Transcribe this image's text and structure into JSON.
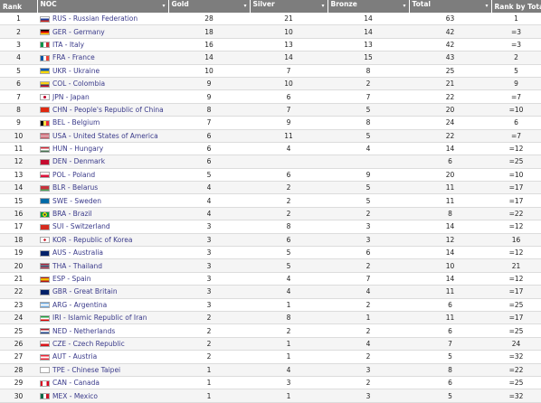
{
  "headers": {
    "rank": "Rank",
    "noc": "NOC",
    "gold": "Gold",
    "silver": "Silver",
    "bronze": "Bronze",
    "total": "Total",
    "rank_by_total": "Rank by Total",
    "sort_icon": "▾"
  },
  "rows": [
    {
      "rank": "1",
      "noc": "RUS - Russian Federation",
      "gold": "28",
      "silver": "21",
      "bronze": "14",
      "total": "63",
      "rbt": "1",
      "flag": "linear-gradient(#ffffff 33%,#1c3f9e 33% 66%,#d52b1e 66%)"
    },
    {
      "rank": "2",
      "noc": "GER - Germany",
      "gold": "18",
      "silver": "10",
      "bronze": "14",
      "total": "42",
      "rbt": "=3",
      "flag": "linear-gradient(#000000 33%,#dd0000 33% 66%,#ffce00 66%)"
    },
    {
      "rank": "3",
      "noc": "ITA - Italy",
      "gold": "16",
      "silver": "13",
      "bronze": "13",
      "total": "42",
      "rbt": "=3",
      "flag": "linear-gradient(90deg,#009246 33%,#ffffff 33% 66%,#ce2b37 66%)"
    },
    {
      "rank": "4",
      "noc": "FRA - France",
      "gold": "14",
      "silver": "14",
      "bronze": "15",
      "total": "43",
      "rbt": "2",
      "flag": "linear-gradient(90deg,#0055a4 33%,#ffffff 33% 66%,#ef4135 66%)"
    },
    {
      "rank": "5",
      "noc": "UKR - Ukraine",
      "gold": "10",
      "silver": "7",
      "bronze": "8",
      "total": "25",
      "rbt": "5",
      "flag": "linear-gradient(#0057b7 50%,#ffd700 50%)"
    },
    {
      "rank": "6",
      "noc": "COL - Colombia",
      "gold": "9",
      "silver": "10",
      "bronze": "2",
      "total": "21",
      "rbt": "9",
      "flag": "linear-gradient(#fcd116 50%,#003893 50% 75%,#ce1126 75%)"
    },
    {
      "rank": "7",
      "noc": "JPN - Japan",
      "gold": "9",
      "silver": "6",
      "bronze": "7",
      "total": "22",
      "rbt": "=7",
      "flag": "radial-gradient(circle,#bc002d 28%,#ffffff 30%)"
    },
    {
      "rank": "8",
      "noc": "CHN - People's Republic of China",
      "gold": "8",
      "silver": "7",
      "bronze": "5",
      "total": "20",
      "rbt": "=10",
      "flag": "linear-gradient(#de2910,#de2910)"
    },
    {
      "rank": "9",
      "noc": "BEL - Belgium",
      "gold": "7",
      "silver": "9",
      "bronze": "8",
      "total": "24",
      "rbt": "6",
      "flag": "linear-gradient(90deg,#000000 33%,#fae042 33% 66%,#ed2939 66%)"
    },
    {
      "rank": "10",
      "noc": "USA - United States of America",
      "gold": "6",
      "silver": "11",
      "bronze": "5",
      "total": "22",
      "rbt": "=7",
      "flag": "repeating-linear-gradient(#b22234 0 1px,#ffffff 1px 2px)"
    },
    {
      "rank": "11",
      "noc": "HUN - Hungary",
      "gold": "6",
      "silver": "4",
      "bronze": "4",
      "total": "14",
      "rbt": "=12",
      "flag": "linear-gradient(#ce2939 33%,#ffffff 33% 66%,#477050 66%)"
    },
    {
      "rank": "12",
      "noc": "DEN - Denmark",
      "gold": "6",
      "silver": "",
      "bronze": "",
      "total": "6",
      "rbt": "=25",
      "flag": "linear-gradient(#c60c30,#c60c30)"
    },
    {
      "rank": "13",
      "noc": "POL - Poland",
      "gold": "5",
      "silver": "6",
      "bronze": "9",
      "total": "20",
      "rbt": "=10",
      "flag": "linear-gradient(#ffffff 50%,#dc143c 50%)"
    },
    {
      "rank": "14",
      "noc": "BLR - Belarus",
      "gold": "4",
      "silver": "2",
      "bronze": "5",
      "total": "11",
      "rbt": "=17",
      "flag": "linear-gradient(#c8313e 66%,#4aa657 66%)"
    },
    {
      "rank": "15",
      "noc": "SWE - Sweden",
      "gold": "4",
      "silver": "2",
      "bronze": "5",
      "total": "11",
      "rbt": "=17",
      "flag": "linear-gradient(#006aa7,#006aa7)"
    },
    {
      "rank": "16",
      "noc": "BRA - Brazil",
      "gold": "4",
      "silver": "2",
      "bronze": "2",
      "total": "8",
      "rbt": "=22",
      "flag": "radial-gradient(circle,#002776 20%,#fedf00 22% 45%,#009c3b 47%)"
    },
    {
      "rank": "17",
      "noc": "SUI - Switzerland",
      "gold": "3",
      "silver": "8",
      "bronze": "3",
      "total": "14",
      "rbt": "=12",
      "flag": "linear-gradient(#d52b1e,#d52b1e)"
    },
    {
      "rank": "18",
      "noc": "KOR - Republic of Korea",
      "gold": "3",
      "silver": "6",
      "bronze": "3",
      "total": "12",
      "rbt": "16",
      "flag": "radial-gradient(circle,#cd2e3a 25%,#ffffff 28%)"
    },
    {
      "rank": "19",
      "noc": "AUS - Australia",
      "gold": "3",
      "silver": "5",
      "bronze": "6",
      "total": "14",
      "rbt": "=12",
      "flag": "linear-gradient(#012169,#012169)"
    },
    {
      "rank": "20",
      "noc": "THA - Thailand",
      "gold": "3",
      "silver": "5",
      "bronze": "2",
      "total": "10",
      "rbt": "21",
      "flag": "linear-gradient(#a51931 16%,#f4f5f8 16% 33%,#2d2a4a 33% 66%,#f4f5f8 66% 83%,#a51931 83%)"
    },
    {
      "rank": "21",
      "noc": "ESP - Spain",
      "gold": "3",
      "silver": "4",
      "bronze": "7",
      "total": "14",
      "rbt": "=12",
      "flag": "linear-gradient(#aa151b 25%,#f1bf00 25% 75%,#aa151b 75%)"
    },
    {
      "rank": "22",
      "noc": "GBR - Great Britain",
      "gold": "3",
      "silver": "4",
      "bronze": "4",
      "total": "11",
      "rbt": "=17",
      "flag": "linear-gradient(#012169,#012169)"
    },
    {
      "rank": "23",
      "noc": "ARG - Argentina",
      "gold": "3",
      "silver": "1",
      "bronze": "2",
      "total": "6",
      "rbt": "=25",
      "flag": "linear-gradient(#74acdf 33%,#ffffff 33% 66%,#74acdf 66%)"
    },
    {
      "rank": "24",
      "noc": "IRI - Islamic Republic of Iran",
      "gold": "2",
      "silver": "8",
      "bronze": "1",
      "total": "11",
      "rbt": "=17",
      "flag": "linear-gradient(#239f40 33%,#ffffff 33% 66%,#da0000 66%)"
    },
    {
      "rank": "25",
      "noc": "NED - Netherlands",
      "gold": "2",
      "silver": "2",
      "bronze": "2",
      "total": "6",
      "rbt": "=25",
      "flag": "linear-gradient(#ae1c28 33%,#ffffff 33% 66%,#21468b 66%)"
    },
    {
      "rank": "26",
      "noc": "CZE - Czech Republic",
      "gold": "2",
      "silver": "1",
      "bronze": "4",
      "total": "7",
      "rbt": "24",
      "flag": "linear-gradient(#ffffff 50%,#d7141a 50%)"
    },
    {
      "rank": "27",
      "noc": "AUT - Austria",
      "gold": "2",
      "silver": "1",
      "bronze": "2",
      "total": "5",
      "rbt": "=32",
      "flag": "linear-gradient(#ed2939 33%,#ffffff 33% 66%,#ed2939 66%)"
    },
    {
      "rank": "28",
      "noc": "TPE - Chinese Taipei",
      "gold": "1",
      "silver": "4",
      "bronze": "3",
      "total": "8",
      "rbt": "=22",
      "flag": "linear-gradient(#ffffff,#ffffff)"
    },
    {
      "rank": "29",
      "noc": "CAN - Canada",
      "gold": "1",
      "silver": "3",
      "bronze": "2",
      "total": "6",
      "rbt": "=25",
      "flag": "linear-gradient(90deg,#d80621 25%,#ffffff 25% 75%,#d80621 75%)"
    },
    {
      "rank": "30",
      "noc": "MEX - Mexico",
      "gold": "1",
      "silver": "1",
      "bronze": "3",
      "total": "5",
      "rbt": "=32",
      "flag": "linear-gradient(90deg,#006847 33%,#ffffff 33% 66%,#ce1126 66%)"
    }
  ]
}
